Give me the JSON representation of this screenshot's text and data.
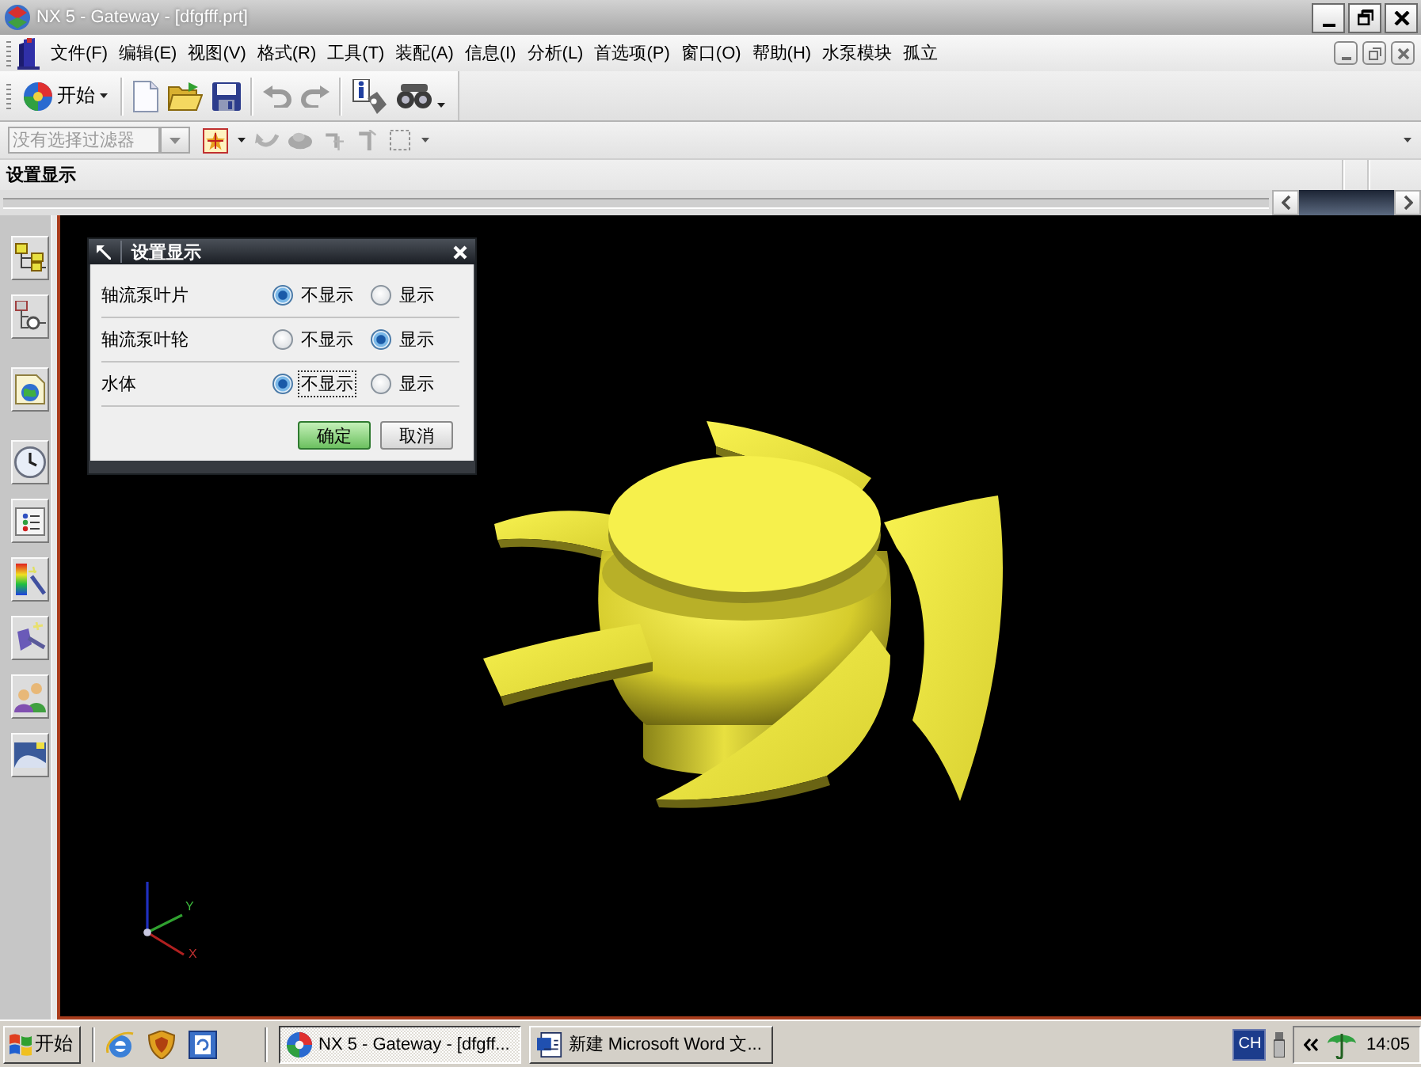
{
  "window": {
    "title": "NX 5 - Gateway - [dfgfff.prt]"
  },
  "menu_bar": {
    "items": [
      "文件(F)",
      "编辑(E)",
      "视图(V)",
      "格式(R)",
      "工具(T)",
      "装配(A)",
      "信息(I)",
      "分析(L)",
      "首选项(P)",
      "窗口(O)",
      "帮助(H)",
      "水泵模块",
      "孤立"
    ]
  },
  "toolbar": {
    "start_button": "开始"
  },
  "selection_bar": {
    "filter": {
      "value": "没有选择过滤器",
      "disabled": true
    }
  },
  "cue_line": "设置显示",
  "dialog": {
    "title": "设置显示",
    "rows": [
      {
        "label": "轴流泵叶片",
        "options": [
          {
            "label": "不显示",
            "selected": true,
            "focused": false
          },
          {
            "label": "显示",
            "selected": false,
            "focused": false
          }
        ]
      },
      {
        "label": "轴流泵叶轮",
        "options": [
          {
            "label": "不显示",
            "selected": false,
            "focused": false
          },
          {
            "label": "显示",
            "selected": true,
            "focused": false
          }
        ]
      },
      {
        "label": "水体",
        "options": [
          {
            "label": "不显示",
            "selected": true,
            "focused": true
          },
          {
            "label": "显示",
            "selected": false,
            "focused": false
          }
        ]
      }
    ],
    "buttons": [
      {
        "label": "确定",
        "default": true
      },
      {
        "label": "取消",
        "default": false
      }
    ]
  },
  "view_triad": {
    "axis_labels": [
      "Y",
      "X"
    ]
  },
  "taskbar": {
    "start_button": "开始",
    "tasks": [
      {
        "label": "NX 5 - Gateway - [dfgff...",
        "selected": true
      },
      {
        "label": "新建 Microsoft Word 文...",
        "selected": false
      }
    ],
    "language": "CH",
    "clock": "14:05"
  }
}
